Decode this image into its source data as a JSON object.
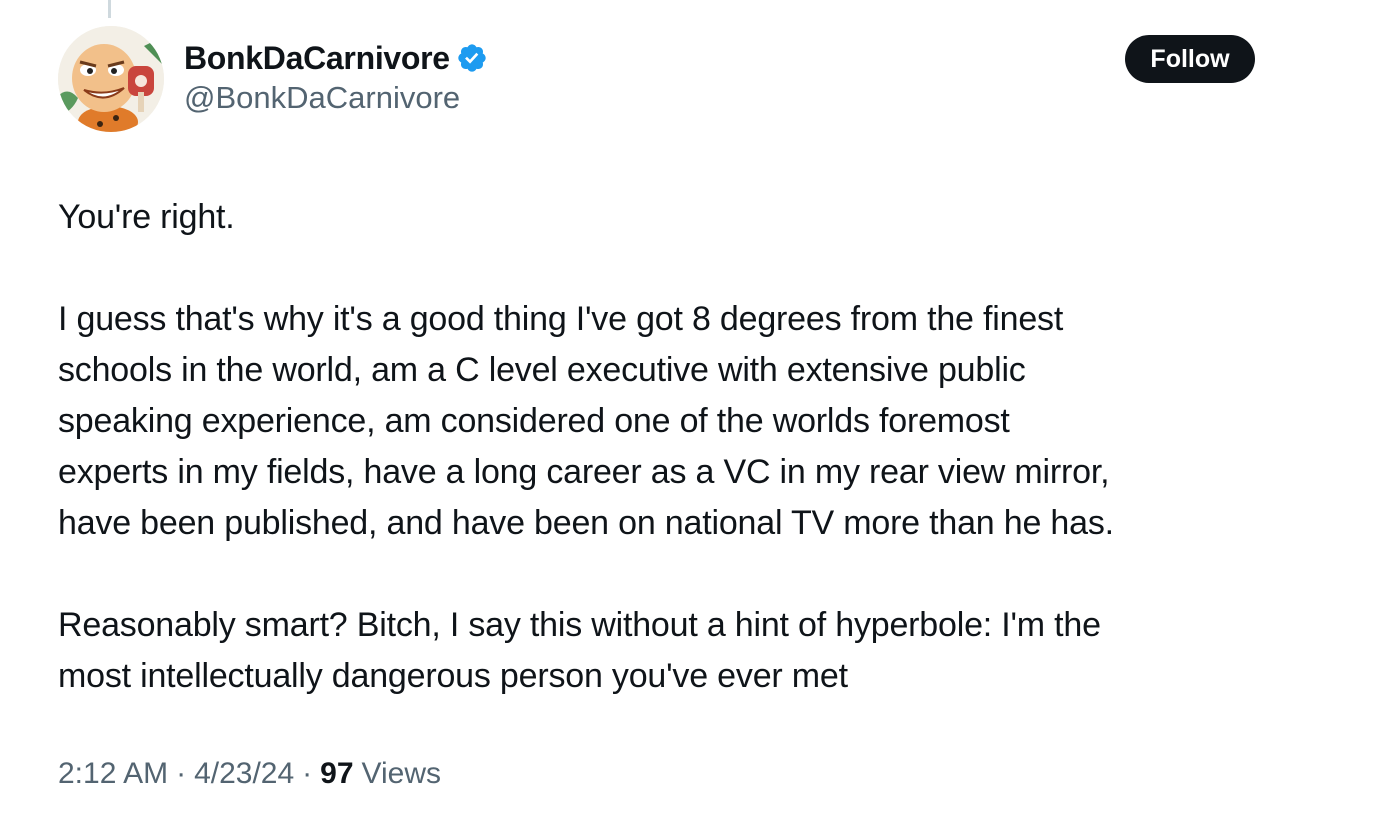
{
  "author": {
    "display_name": "BonkDaCarnivore",
    "handle": "@BonkDaCarnivore",
    "verified_icon": "verified-badge-icon",
    "verified_color": "#1d9bf0"
  },
  "follow_label": "Follow",
  "tweet": {
    "paragraphs": [
      "You're right.",
      "I guess that's why it's a good thing I've got 8 degrees from the finest\nschools in the world, am a C level executive with extensive public\nspeaking experience, am considered one of the worlds foremost\nexperts in my fields, have a long career as a VC in my rear view mirror,\nhave been published, and have been on national TV more than he has.",
      "Reasonably smart? Bitch, I say this without a hint of hyperbole: I'm the\nmost intellectually dangerous person you've ever met"
    ]
  },
  "meta": {
    "time": "2:12 AM",
    "separator": "·",
    "date": "4/23/24",
    "views_count": "97",
    "views_label": "Views"
  }
}
